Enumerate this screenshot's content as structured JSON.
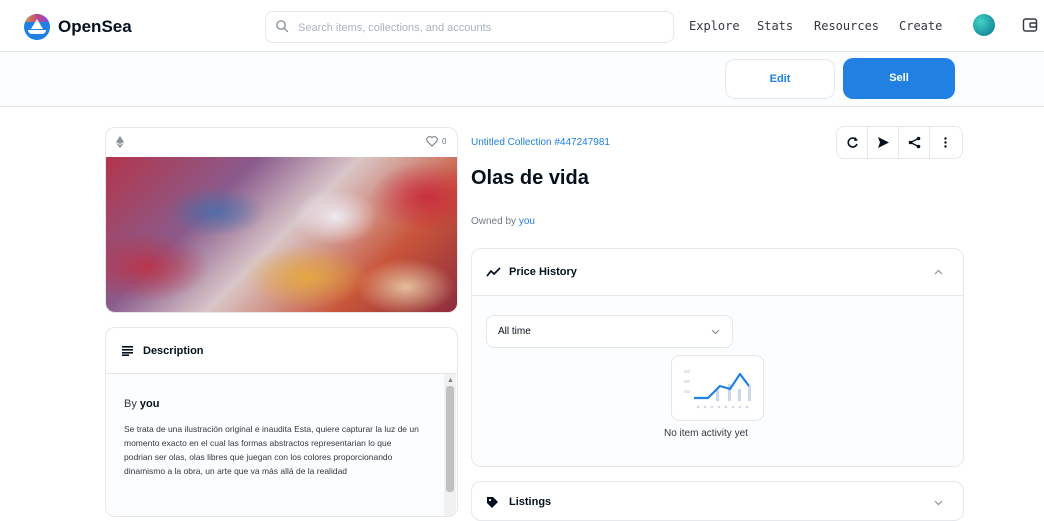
{
  "header": {
    "brand": "OpenSea",
    "search_placeholder": "Search items, collections, and accounts",
    "nav": [
      "Explore",
      "Stats",
      "Resources",
      "Create"
    ]
  },
  "owner_bar": {
    "edit_label": "Edit",
    "sell_label": "Sell"
  },
  "item": {
    "favorite_count": "0",
    "collection": "Untitled Collection #447247981",
    "title": "Olas de vida",
    "owned_by_label": "Owned by",
    "owner": "you"
  },
  "description": {
    "title": "Description",
    "by_label": "By",
    "by_user": "you",
    "text": "Se trata de una ilustración original e inaudita Esta, quiere capturar la luz de un momento exacto en el cual las formas abstractos representarian lo que podrian ser olas, olas libres que juegan con los colores proporcionando dinamismo a la obra, un arte que va más allá de la realidad"
  },
  "price_history": {
    "title": "Price History",
    "time_filter": "All time",
    "empty_text": "No item activity yet"
  },
  "listings": {
    "title": "Listings"
  },
  "colors": {
    "accent": "#2081e2",
    "text": "#04111d",
    "border": "#e5e8eb"
  },
  "icons": [
    "opensea-logo-icon",
    "search-icon",
    "wallet-icon",
    "ethereum-icon",
    "heart-icon",
    "refresh-icon",
    "transfer-icon",
    "share-icon",
    "more-icon",
    "description-icon",
    "trend-icon",
    "chevron-up-icon",
    "chevron-down-icon",
    "tag-icon"
  ]
}
